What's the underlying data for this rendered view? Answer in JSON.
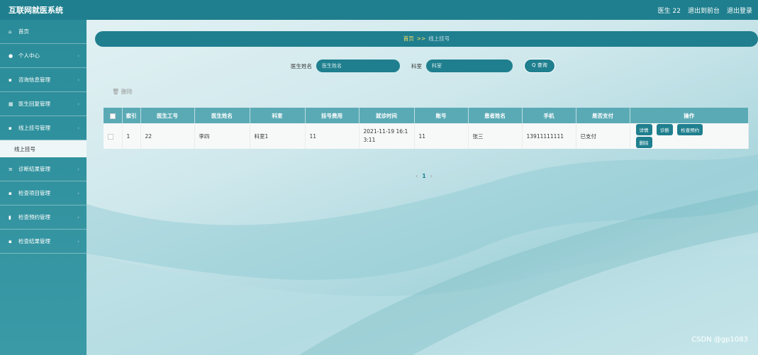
{
  "app": {
    "title": "互联网就医系统"
  },
  "topbar": {
    "user": "医生 22",
    "backstage": "退出到前台",
    "logout": "退出登录"
  },
  "sidebar": {
    "items": [
      {
        "icon": "home-icon",
        "glyph": "⌂",
        "label": "首页"
      },
      {
        "icon": "user-icon",
        "glyph": "●",
        "label": "个人中心"
      },
      {
        "icon": "grid-icon",
        "glyph": "▪",
        "label": "咨询信息管理"
      },
      {
        "icon": "grid-icon",
        "glyph": "▦",
        "label": "医生回复管理"
      },
      {
        "icon": "grid-icon",
        "glyph": "▪",
        "label": "线上挂号管理"
      },
      {
        "icon": "list-icon",
        "glyph": "≡",
        "label": "诊断结果管理"
      },
      {
        "icon": "grid-icon",
        "glyph": "▪",
        "label": "检查项目管理"
      },
      {
        "icon": "trash-icon",
        "glyph": "▮",
        "label": "检查预约管理"
      },
      {
        "icon": "grid-icon",
        "glyph": "▪",
        "label": "检查结果管理"
      }
    ],
    "sub_item": "线上挂号"
  },
  "breadcrumb": {
    "home": "首页",
    "sep": ">>",
    "current": "线上挂号"
  },
  "search": {
    "doctor_label": "医生姓名",
    "doctor_placeholder": "医生姓名",
    "dept_label": "科室",
    "dept_placeholder": "科室",
    "button": "Q 查询"
  },
  "toolbar": {
    "delete": "🗑 删除"
  },
  "table": {
    "headers": [
      "索引",
      "医生工号",
      "医生姓名",
      "科室",
      "挂号费用",
      "就诊时间",
      "账号",
      "患者姓名",
      "手机",
      "是否支付",
      "操作"
    ],
    "rows": [
      {
        "index": "1",
        "doctor_id": "22",
        "doctor_name": "李四",
        "dept": "科室1",
        "fee": "11",
        "time": "2021-11-19 16:1\n3:11",
        "account": "11",
        "patient": "张三",
        "phone": "13911111111",
        "paid": "已支付"
      }
    ],
    "actions": [
      "详情",
      "诊断",
      "检查预约",
      "删除"
    ]
  },
  "pager": {
    "prev": "‹",
    "page": "1",
    "next": "›"
  },
  "watermark": "CSDN @gp1083"
}
